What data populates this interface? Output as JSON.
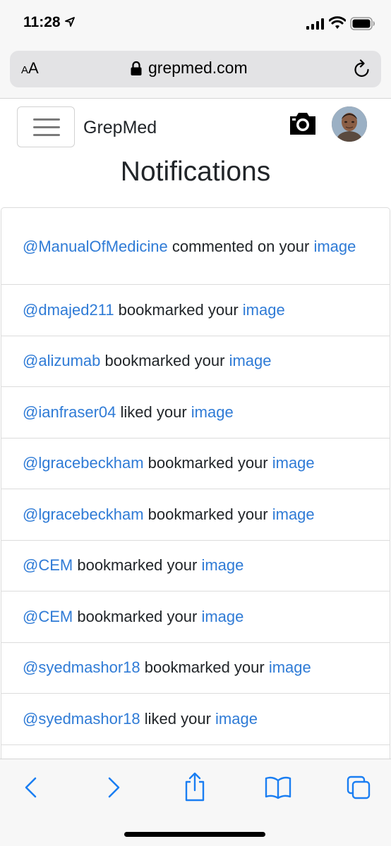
{
  "status_bar": {
    "time": "11:28"
  },
  "browser": {
    "text_size_label_small": "A",
    "text_size_label_large": "A",
    "url": "grepmed.com"
  },
  "navbar": {
    "brand": "GrepMed"
  },
  "page": {
    "title": "Notifications"
  },
  "notifications": [
    {
      "user": "@ManualOfMedicine",
      "action": " commented on your ",
      "link": "image"
    },
    {
      "user": "@dmajed211",
      "action": " bookmarked your ",
      "link": "image"
    },
    {
      "user": "@alizumab",
      "action": " bookmarked your ",
      "link": "image"
    },
    {
      "user": "@ianfraser04",
      "action": " liked your ",
      "link": "image"
    },
    {
      "user": "@lgracebeckham",
      "action": " bookmarked your ",
      "link": "image"
    },
    {
      "user": "@lgracebeckham",
      "action": " bookmarked your ",
      "link": "image"
    },
    {
      "user": "@CEM",
      "action": " bookmarked your ",
      "link": "image"
    },
    {
      "user": "@CEM",
      "action": " bookmarked your ",
      "link": "image"
    },
    {
      "user": "@syedmashor18",
      "action": " bookmarked your ",
      "link": "image"
    },
    {
      "user": "@syedmashor18",
      "action": " liked your ",
      "link": "image"
    }
  ],
  "icons": {
    "back": "chevron-left-icon",
    "forward": "chevron-right-icon",
    "share": "share-icon",
    "bookmarks": "book-icon",
    "tabs": "tabs-icon",
    "camera": "camera-icon",
    "lock": "lock-icon",
    "reload": "reload-icon"
  },
  "colors": {
    "link": "#2f7bd6",
    "ios_blue": "#1a7ef2",
    "text": "#212529"
  }
}
